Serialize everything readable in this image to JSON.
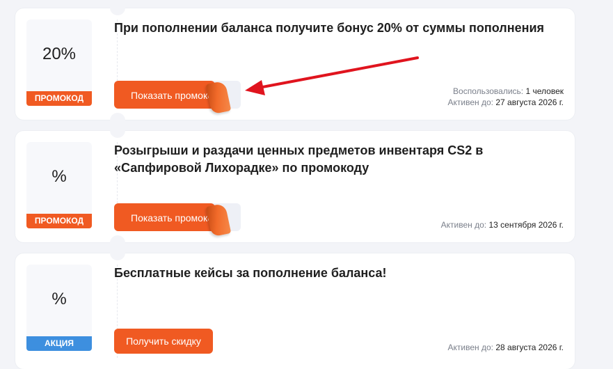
{
  "offers": [
    {
      "discount": "20%",
      "tag": "ПРОМОКОД",
      "title": "При пополнении баланса получите бонус 20% от суммы пополнения",
      "button_label": "Показать промокод",
      "used_label": "Воспользовались:",
      "used_value": "1 человек",
      "active_label": "Активен до:",
      "active_value": "27 августа 2026 г."
    },
    {
      "discount": "%",
      "tag": "ПРОМОКОД",
      "title": "Розыгрыши и раздачи ценных предметов инвентаря CS2 в «Сапфировой Лихорадке» по промокоду",
      "button_label": "Показать промокод",
      "active_label": "Активен до:",
      "active_value": "13 сентября 2026 г."
    },
    {
      "discount": "%",
      "tag": "АКЦИЯ",
      "title": "Бесплатные кейсы за пополнение баланса!",
      "button_label": "Получить скидку",
      "active_label": "Активен до:",
      "active_value": "28 августа 2026 г."
    }
  ],
  "colors": {
    "accent": "#f05a22",
    "action_tag": "#3d8fdf",
    "annotation_arrow": "#e0141e"
  }
}
